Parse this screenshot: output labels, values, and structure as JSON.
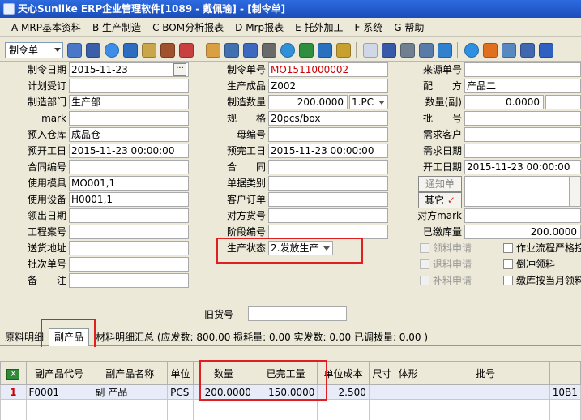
{
  "window": {
    "title": "天心Sunlike ERP企业管理软件[1089 - 戴佩瑜] - [制令单]"
  },
  "menu": [
    {
      "key": "A",
      "label": "MRP基本资料"
    },
    {
      "key": "B",
      "label": "生产制造"
    },
    {
      "key": "C",
      "label": "BOM分析报表"
    },
    {
      "key": "D",
      "label": "Mrp报表"
    },
    {
      "key": "E",
      "label": "托外加工"
    },
    {
      "key": "F",
      "label": "系统"
    },
    {
      "key": "G",
      "label": "帮助"
    }
  ],
  "toolbar": {
    "doc_type": "制令单"
  },
  "form": {
    "labels": {
      "make_date": "制令日期",
      "plan_order": "计划受订",
      "dept": "制造部门",
      "mark": "mark",
      "warehouse": "预入仓库",
      "plan_start": "预开工日",
      "contract_no": "合同编号",
      "mold": "使用模具",
      "equipment": "使用设备",
      "issue_date": "领出日期",
      "project": "工程案号",
      "address": "送货地址",
      "batch": "批次单号",
      "remark": "备　　注",
      "order_no": "制令单号",
      "product": "生产成品",
      "qty": "制造数量",
      "spec": "规　　格",
      "parent_no": "母编号",
      "plan_end": "预完工日",
      "contract": "合　　同",
      "doc_cat": "单据类别",
      "cust_order": "客户订单",
      "cust_part": "对方货号",
      "stage_no": "阶段编号",
      "status": "生产状态",
      "source_no": "来源单号",
      "config": "配　　方",
      "qty_sub": "数量(副)",
      "lot": "批　　号",
      "need_cust": "需求客户",
      "need_date": "需求日期",
      "start_date": "开工日期",
      "other_mark": "对方mark",
      "paid_qty": "已缴库量",
      "old_part": "旧货号"
    },
    "values": {
      "make_date": "2015-11-23",
      "dept": "生产部",
      "warehouse": "成品仓",
      "plan_start": "2015-11-23 00:00:00",
      "mold": "MO001,1",
      "equipment": "H0001,1",
      "order_no": "MO1511000002",
      "product": "Z002",
      "qty": "200.0000",
      "unit": "1.PC",
      "spec": "20pcs/box",
      "plan_end": "2015-11-23 00:00:00",
      "status": "2.发放生产",
      "config": "产品二",
      "qty_sub": "0.0000",
      "start_date": "2015-11-23 00:00:00",
      "paid_qty": "200.0000"
    },
    "buttons": {
      "notify": "通知单",
      "other": "其它"
    },
    "checks": {
      "mat_apply": "领料申请",
      "ret_apply": "退料申请",
      "sup_apply": "补料申请",
      "flow_strict": "作业流程严格控",
      "backflush": "倒冲领料",
      "stock_month": "缴库按当月领料"
    }
  },
  "tabs": [
    {
      "label": "原料明细"
    },
    {
      "label": "副产品"
    },
    {
      "label": "材料明细汇总 (应发数: 800.00 损耗量: 0.00 实发数: 0.00 已调拨量: 0.00 )"
    }
  ],
  "grid": {
    "columns": [
      "副产品代号",
      "副产品名称",
      "单位",
      "数量",
      "已完工量",
      "单位成本",
      "尺寸",
      "体形",
      "批号",
      ""
    ],
    "rows": [
      {
        "idx": "1",
        "code": "F0001",
        "name": "副 产品",
        "unit": "PCS",
        "qty": "200.0000",
        "done": "150.0000",
        "cost": "2.500",
        "size": "",
        "shape": "",
        "batch": "",
        "extra": "10B1"
      }
    ]
  },
  "colors": {
    "title": "#1b4db8",
    "highlight": "#e02020",
    "order_no": "#cc0000"
  }
}
